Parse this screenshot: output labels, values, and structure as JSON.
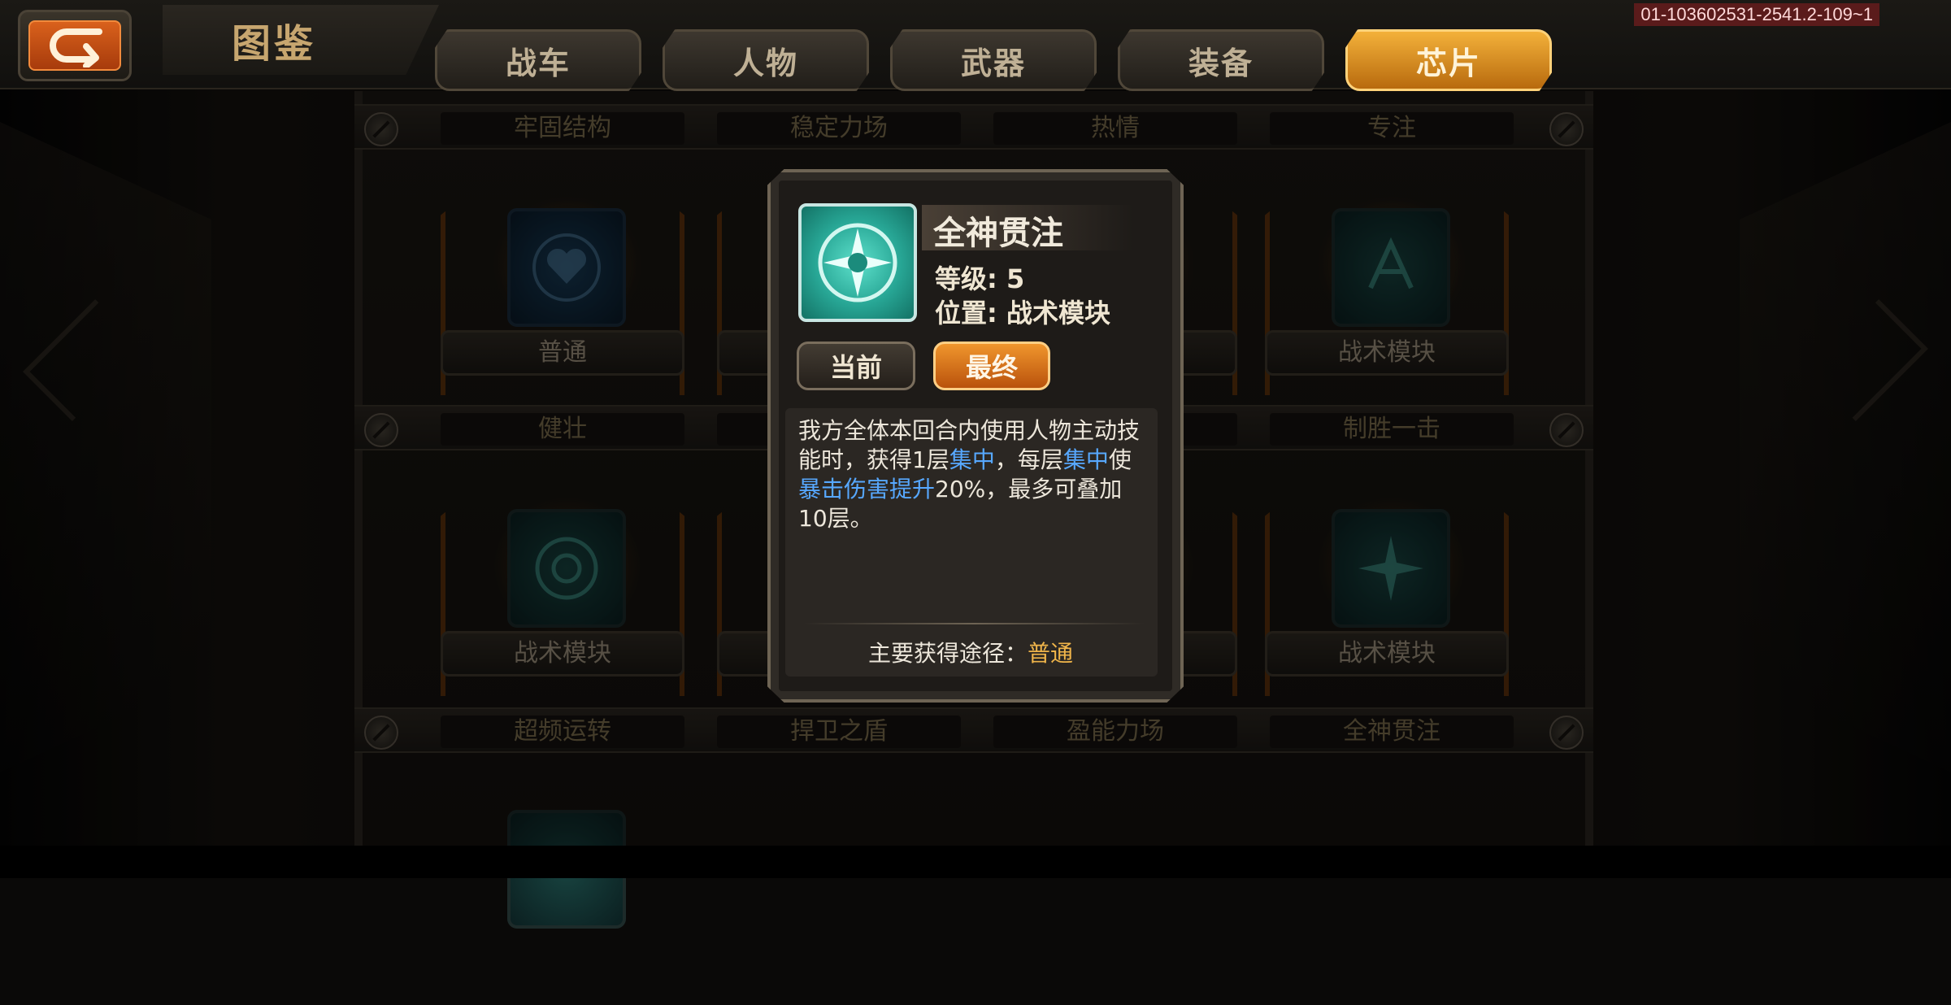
{
  "header": {
    "title": "图鉴",
    "build_id": "01-103602531-2541.2-109~1",
    "tabs": [
      {
        "label": "战车",
        "active": false
      },
      {
        "label": "人物",
        "active": false
      },
      {
        "label": "武器",
        "active": false
      },
      {
        "label": "装备",
        "active": false
      },
      {
        "label": "芯片",
        "active": true
      }
    ]
  },
  "grid": {
    "row1_headers": [
      "牢固结构",
      "稳定力场",
      "热情",
      "专注"
    ],
    "row1_labels": [
      "普通",
      "",
      "",
      "战术模块"
    ],
    "row2_headers": [
      "健壮",
      "",
      "",
      "制胜一击"
    ],
    "row2_labels": [
      "战术模块",
      "",
      "",
      "战术模块"
    ],
    "row3_headers": [
      "超频运转",
      "捍卫之盾",
      "盈能力场",
      "全神贯注"
    ]
  },
  "popup": {
    "name": "全神贯注",
    "level_label": "等级:",
    "level_value": "5",
    "position_label": "位置:",
    "position_value": "战术模块",
    "btn_current": "当前",
    "btn_final": "最终",
    "desc_parts": [
      "我方全体本回合内使用人物主动技能时，获得1层",
      "集中",
      "，每层",
      "集中",
      "使",
      "暴击伤害提升",
      "20%，最多可叠加10层。"
    ],
    "source_label": "主要获得途径：",
    "source_value": "普通"
  },
  "colors": {
    "accent_orange": "#f0962d",
    "keyword_blue": "#57a8ff",
    "source_gold": "#f0b54a"
  }
}
